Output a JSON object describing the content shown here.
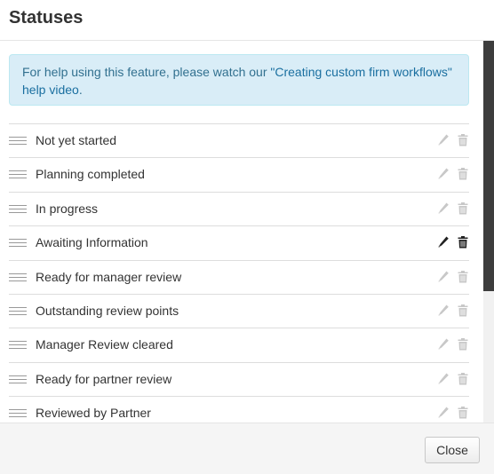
{
  "dialog": {
    "title": "Statuses",
    "close_label": "Close"
  },
  "help": {
    "text_before": "For help using this feature, please watch our ",
    "link_text": "\"Creating custom firm workflows\" help video",
    "text_after": "."
  },
  "statuses": [
    {
      "label": "Not yet started",
      "highlighted": false
    },
    {
      "label": "Planning completed",
      "highlighted": false
    },
    {
      "label": "In progress",
      "highlighted": false
    },
    {
      "label": "Awaiting Information",
      "highlighted": true
    },
    {
      "label": "Ready for manager review",
      "highlighted": false
    },
    {
      "label": "Outstanding review points",
      "highlighted": false
    },
    {
      "label": "Manager Review cleared",
      "highlighted": false
    },
    {
      "label": "Ready for partner review",
      "highlighted": false
    },
    {
      "label": "Reviewed by Partner",
      "highlighted": false
    }
  ],
  "icons": {
    "drag": "drag-handle-icon",
    "edit": "pencil-icon",
    "delete": "trash-icon"
  },
  "colors": {
    "help_bg": "#d9edf7",
    "help_text": "#31708f",
    "link": "#1a6fa0",
    "icon_dim": "#c8c8c8",
    "icon_active": "#222222"
  }
}
